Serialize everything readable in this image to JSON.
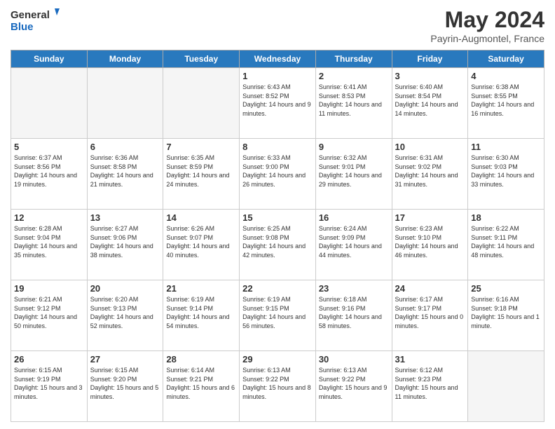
{
  "header": {
    "logo_line1": "General",
    "logo_line2": "Blue",
    "title": "May 2024",
    "subtitle": "Payrin-Augmontel, France"
  },
  "days_of_week": [
    "Sunday",
    "Monday",
    "Tuesday",
    "Wednesday",
    "Thursday",
    "Friday",
    "Saturday"
  ],
  "weeks": [
    [
      {
        "day": "",
        "info": ""
      },
      {
        "day": "",
        "info": ""
      },
      {
        "day": "",
        "info": ""
      },
      {
        "day": "1",
        "info": "Sunrise: 6:43 AM\nSunset: 8:52 PM\nDaylight: 14 hours\nand 9 minutes."
      },
      {
        "day": "2",
        "info": "Sunrise: 6:41 AM\nSunset: 8:53 PM\nDaylight: 14 hours\nand 11 minutes."
      },
      {
        "day": "3",
        "info": "Sunrise: 6:40 AM\nSunset: 8:54 PM\nDaylight: 14 hours\nand 14 minutes."
      },
      {
        "day": "4",
        "info": "Sunrise: 6:38 AM\nSunset: 8:55 PM\nDaylight: 14 hours\nand 16 minutes."
      }
    ],
    [
      {
        "day": "5",
        "info": "Sunrise: 6:37 AM\nSunset: 8:56 PM\nDaylight: 14 hours\nand 19 minutes."
      },
      {
        "day": "6",
        "info": "Sunrise: 6:36 AM\nSunset: 8:58 PM\nDaylight: 14 hours\nand 21 minutes."
      },
      {
        "day": "7",
        "info": "Sunrise: 6:35 AM\nSunset: 8:59 PM\nDaylight: 14 hours\nand 24 minutes."
      },
      {
        "day": "8",
        "info": "Sunrise: 6:33 AM\nSunset: 9:00 PM\nDaylight: 14 hours\nand 26 minutes."
      },
      {
        "day": "9",
        "info": "Sunrise: 6:32 AM\nSunset: 9:01 PM\nDaylight: 14 hours\nand 29 minutes."
      },
      {
        "day": "10",
        "info": "Sunrise: 6:31 AM\nSunset: 9:02 PM\nDaylight: 14 hours\nand 31 minutes."
      },
      {
        "day": "11",
        "info": "Sunrise: 6:30 AM\nSunset: 9:03 PM\nDaylight: 14 hours\nand 33 minutes."
      }
    ],
    [
      {
        "day": "12",
        "info": "Sunrise: 6:28 AM\nSunset: 9:04 PM\nDaylight: 14 hours\nand 35 minutes."
      },
      {
        "day": "13",
        "info": "Sunrise: 6:27 AM\nSunset: 9:06 PM\nDaylight: 14 hours\nand 38 minutes."
      },
      {
        "day": "14",
        "info": "Sunrise: 6:26 AM\nSunset: 9:07 PM\nDaylight: 14 hours\nand 40 minutes."
      },
      {
        "day": "15",
        "info": "Sunrise: 6:25 AM\nSunset: 9:08 PM\nDaylight: 14 hours\nand 42 minutes."
      },
      {
        "day": "16",
        "info": "Sunrise: 6:24 AM\nSunset: 9:09 PM\nDaylight: 14 hours\nand 44 minutes."
      },
      {
        "day": "17",
        "info": "Sunrise: 6:23 AM\nSunset: 9:10 PM\nDaylight: 14 hours\nand 46 minutes."
      },
      {
        "day": "18",
        "info": "Sunrise: 6:22 AM\nSunset: 9:11 PM\nDaylight: 14 hours\nand 48 minutes."
      }
    ],
    [
      {
        "day": "19",
        "info": "Sunrise: 6:21 AM\nSunset: 9:12 PM\nDaylight: 14 hours\nand 50 minutes."
      },
      {
        "day": "20",
        "info": "Sunrise: 6:20 AM\nSunset: 9:13 PM\nDaylight: 14 hours\nand 52 minutes."
      },
      {
        "day": "21",
        "info": "Sunrise: 6:19 AM\nSunset: 9:14 PM\nDaylight: 14 hours\nand 54 minutes."
      },
      {
        "day": "22",
        "info": "Sunrise: 6:19 AM\nSunset: 9:15 PM\nDaylight: 14 hours\nand 56 minutes."
      },
      {
        "day": "23",
        "info": "Sunrise: 6:18 AM\nSunset: 9:16 PM\nDaylight: 14 hours\nand 58 minutes."
      },
      {
        "day": "24",
        "info": "Sunrise: 6:17 AM\nSunset: 9:17 PM\nDaylight: 15 hours\nand 0 minutes."
      },
      {
        "day": "25",
        "info": "Sunrise: 6:16 AM\nSunset: 9:18 PM\nDaylight: 15 hours\nand 1 minute."
      }
    ],
    [
      {
        "day": "26",
        "info": "Sunrise: 6:15 AM\nSunset: 9:19 PM\nDaylight: 15 hours\nand 3 minutes."
      },
      {
        "day": "27",
        "info": "Sunrise: 6:15 AM\nSunset: 9:20 PM\nDaylight: 15 hours\nand 5 minutes."
      },
      {
        "day": "28",
        "info": "Sunrise: 6:14 AM\nSunset: 9:21 PM\nDaylight: 15 hours\nand 6 minutes."
      },
      {
        "day": "29",
        "info": "Sunrise: 6:13 AM\nSunset: 9:22 PM\nDaylight: 15 hours\nand 8 minutes."
      },
      {
        "day": "30",
        "info": "Sunrise: 6:13 AM\nSunset: 9:22 PM\nDaylight: 15 hours\nand 9 minutes."
      },
      {
        "day": "31",
        "info": "Sunrise: 6:12 AM\nSunset: 9:23 PM\nDaylight: 15 hours\nand 11 minutes."
      },
      {
        "day": "",
        "info": ""
      }
    ]
  ]
}
